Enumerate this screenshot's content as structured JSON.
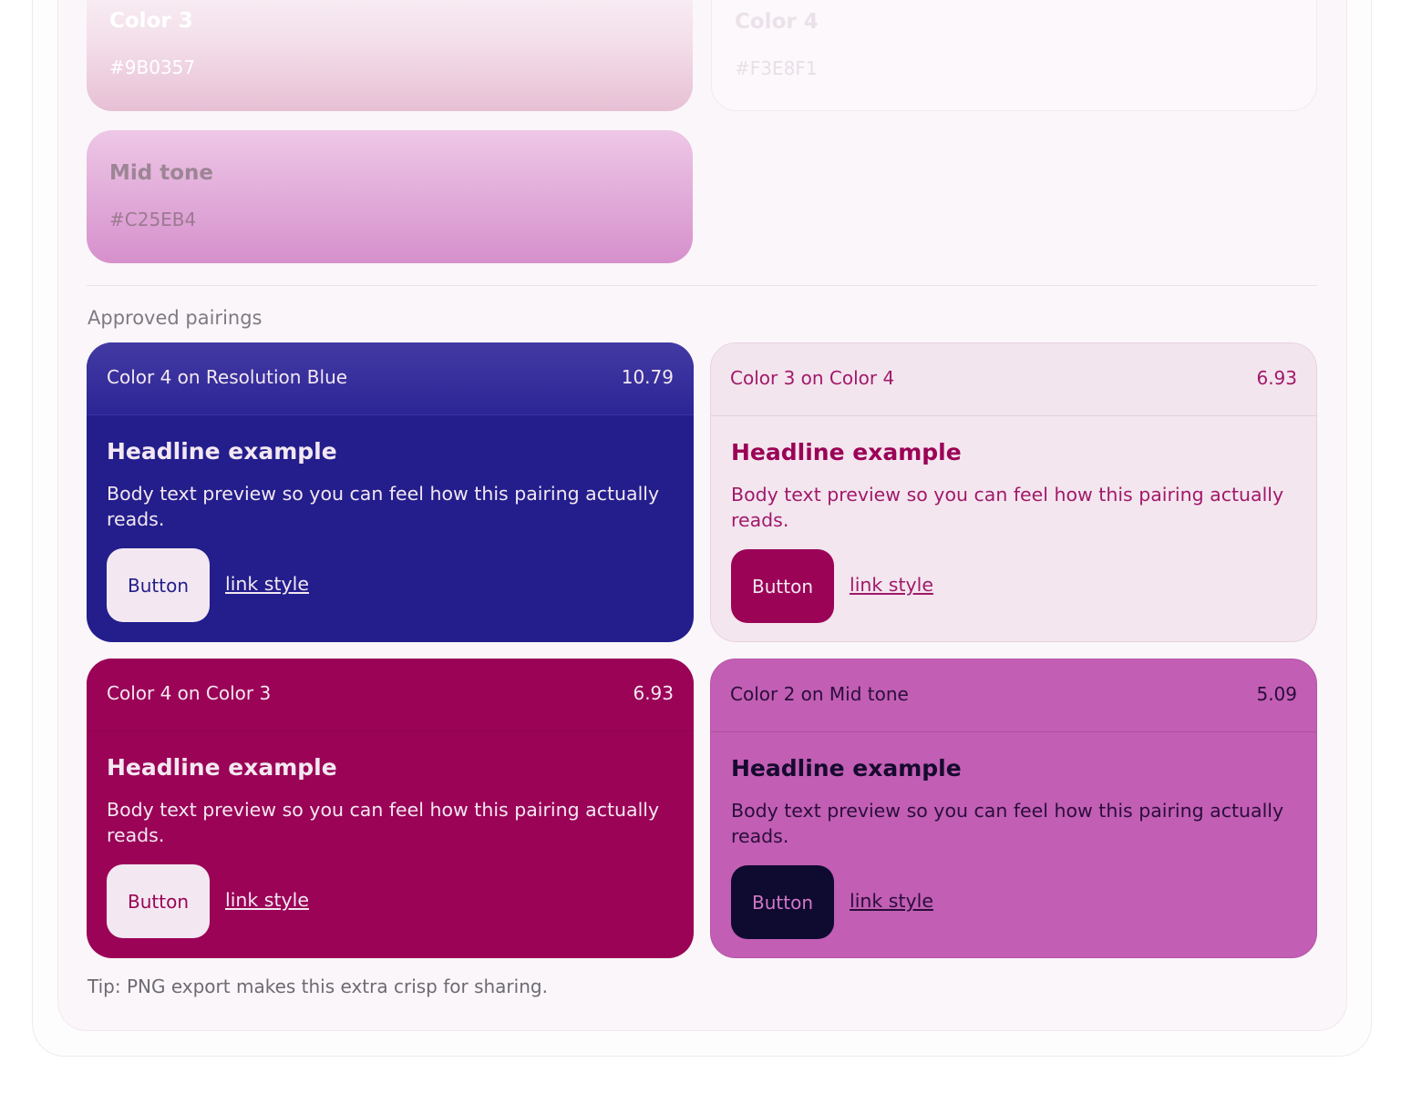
{
  "swatches": [
    {
      "name": "Color 3",
      "hex": "#9B0357"
    },
    {
      "name": "Color 4",
      "hex": "#F3E8F1"
    },
    {
      "name": "Mid tone",
      "hex": "#C25EB4"
    }
  ],
  "section_title": "Approved pairings",
  "cards": [
    {
      "pair": "Color 4 on Resolution Blue",
      "ratio": "10.79",
      "headline": "Headline example",
      "body": "Body text preview so you can feel how this pairing actually reads.",
      "button": "Button",
      "link": "link style"
    },
    {
      "pair": "Color 3 on Color 4",
      "ratio": "6.93",
      "headline": "Headline example",
      "body": "Body text preview so you can feel how this pairing actually reads.",
      "button": "Button",
      "link": "link style"
    },
    {
      "pair": "Color 4 on Color 3",
      "ratio": "6.93",
      "headline": "Headline example",
      "body": "Body text preview so you can feel how this pairing actually reads.",
      "button": "Button",
      "link": "link style"
    },
    {
      "pair": "Color 2 on Mid tone",
      "ratio": "5.09",
      "headline": "Headline example",
      "body": "Body text preview so you can feel how this pairing actually reads.",
      "button": "Button",
      "link": "link style"
    }
  ],
  "tip": "Tip: PNG export makes this extra crisp for sharing.",
  "colors": {
    "resolution_blue": "#231E8C",
    "color3": "#9B0357",
    "color4": "#F3E8F1",
    "mid_tone": "#C25EB4"
  }
}
